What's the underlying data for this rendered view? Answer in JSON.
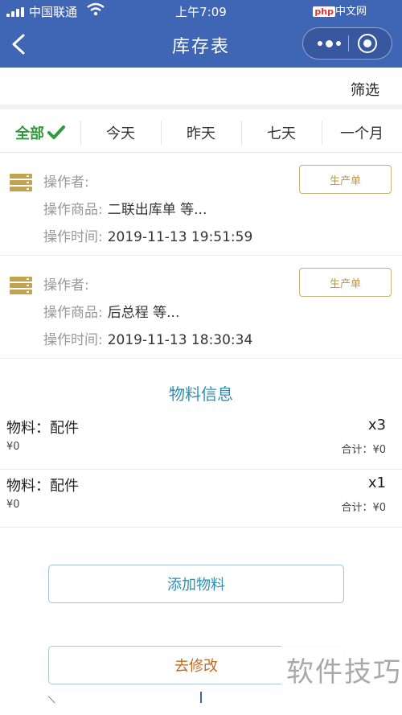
{
  "status_bar": {
    "carrier": "中国联通",
    "time": "上午7:09",
    "badge_text": "php",
    "badge_suffix": "中文网"
  },
  "nav": {
    "title": "库存表",
    "back_icon": "chevron-left-icon",
    "more_icon": "more-dots-icon",
    "close_icon": "target-close-icon"
  },
  "filter": {
    "label": "筛选"
  },
  "tabs": [
    {
      "label": "全部",
      "active": true,
      "icon": "check-icon"
    },
    {
      "label": "今天",
      "active": false
    },
    {
      "label": "昨天",
      "active": false
    },
    {
      "label": "七天",
      "active": false
    },
    {
      "label": "一个月",
      "active": false
    }
  ],
  "records": [
    {
      "operator_label": "操作者:",
      "operator_value": "",
      "goods_label": "操作商品:",
      "goods_value": "二联出库单 等...",
      "time_label": "操作时间:",
      "time_value": "2019-11-13 19:51:59",
      "tag": "生产单"
    },
    {
      "operator_label": "操作者:",
      "operator_value": "",
      "goods_label": "操作商品:",
      "goods_value": "后总程 等...",
      "time_label": "操作时间:",
      "time_value": "2019-11-13 18:30:34",
      "tag": "生产单"
    }
  ],
  "materials": {
    "title": "物料信息",
    "items": [
      {
        "name": "物料：配件",
        "qty": "x3",
        "price": "¥0",
        "total": "合计：¥0"
      },
      {
        "name": "物料：配件",
        "qty": "x1",
        "price": "¥0",
        "total": "合计：¥0"
      }
    ]
  },
  "actions": {
    "add_label": "添加物料",
    "edit_label": "去修改"
  },
  "watermark": "软件技巧",
  "colors": {
    "nav_bg": "#3f65b5",
    "active_tab": "#2e9a3c",
    "tag_border": "#c8b07a",
    "section_title": "#2f8fb0",
    "edit_text": "#c46a1e"
  }
}
